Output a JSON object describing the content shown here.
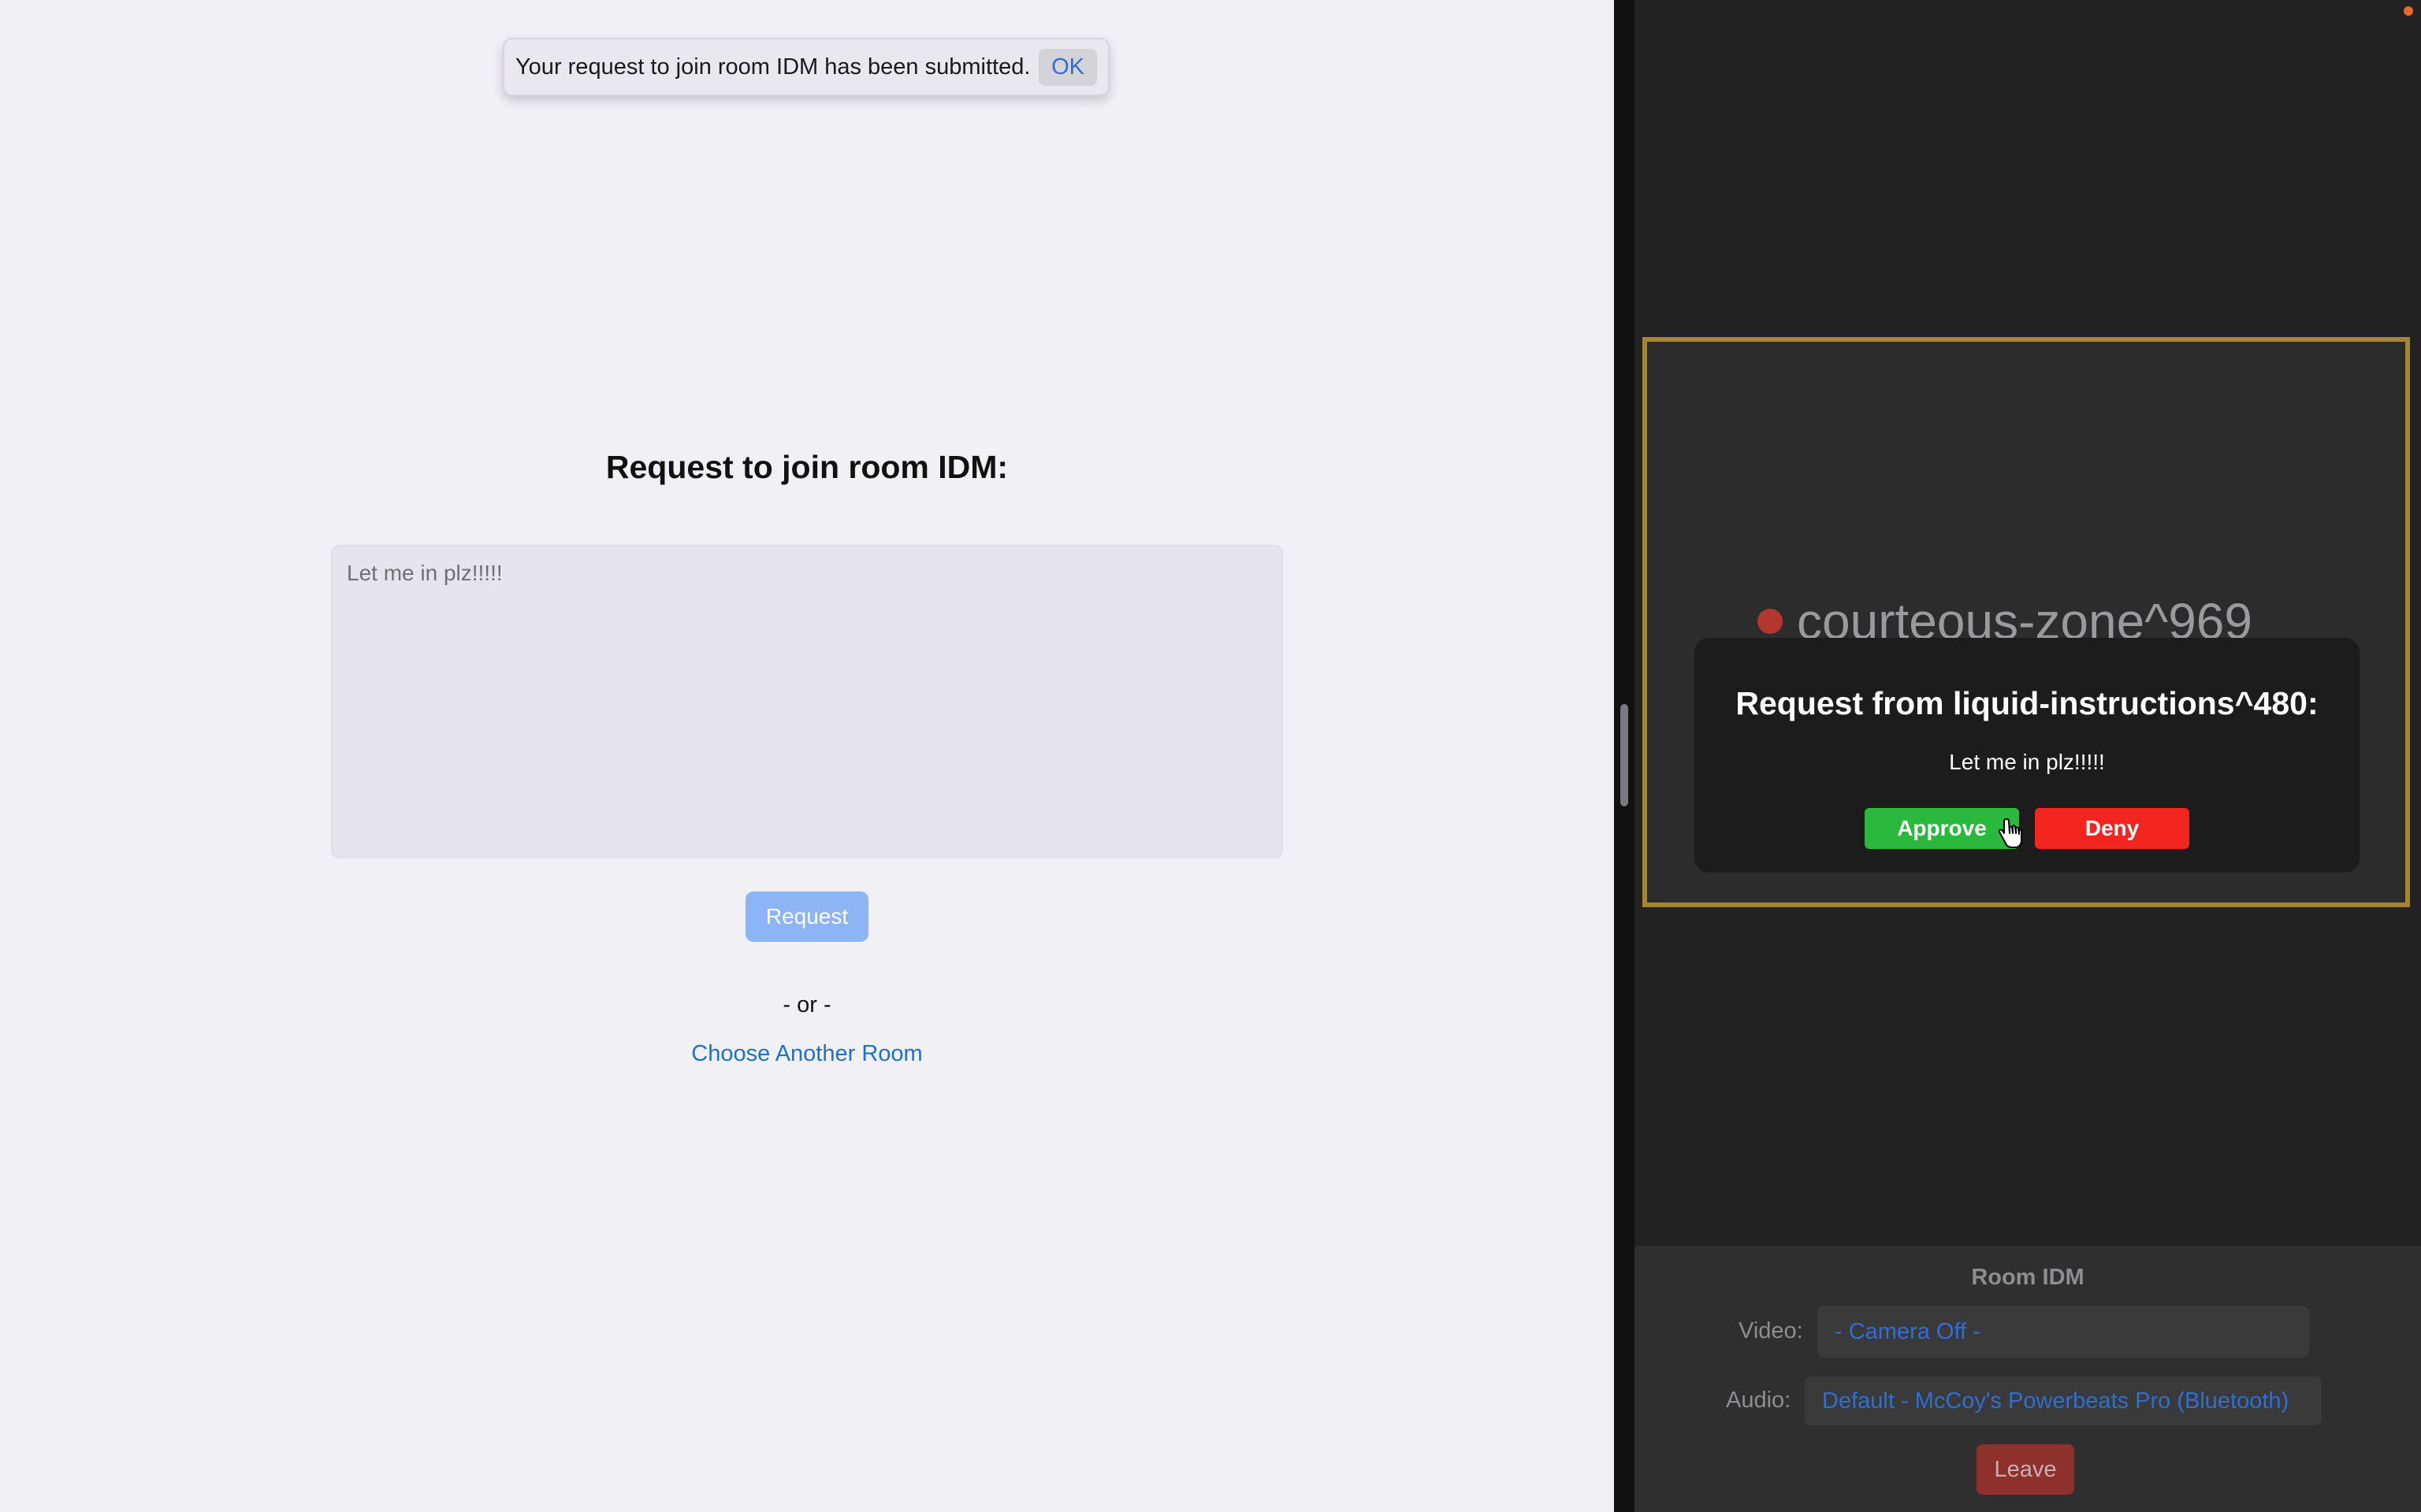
{
  "toast": {
    "message": "Your request to join room IDM has been submitted.",
    "ok_label": "OK"
  },
  "join_form": {
    "title": "Request to join room IDM:",
    "message_value": "Let me in plz!!!!!",
    "request_label": "Request",
    "or_text": "- or -",
    "choose_room_label": "Choose Another Room"
  },
  "video_tile": {
    "participant_name": "courteous-zone^969",
    "status_color": "#b3372f",
    "border_color": "#a38630"
  },
  "join_request_modal": {
    "title": "Request from liquid-instructions^480:",
    "message": "Let me in plz!!!!!",
    "approve_label": "Approve",
    "deny_label": "Deny"
  },
  "controls": {
    "room_label": "Room IDM",
    "video_label": "Video:",
    "video_value": "- Camera Off -",
    "audio_label": "Audio:",
    "audio_value": "Default - McCoy's Powerbeats Pro (Bluetooth)",
    "leave_label": "Leave"
  },
  "colors": {
    "approve": "#2ab93d",
    "deny": "#f2261f",
    "link": "#1f6fcf",
    "request_button": "#8db4f5"
  }
}
